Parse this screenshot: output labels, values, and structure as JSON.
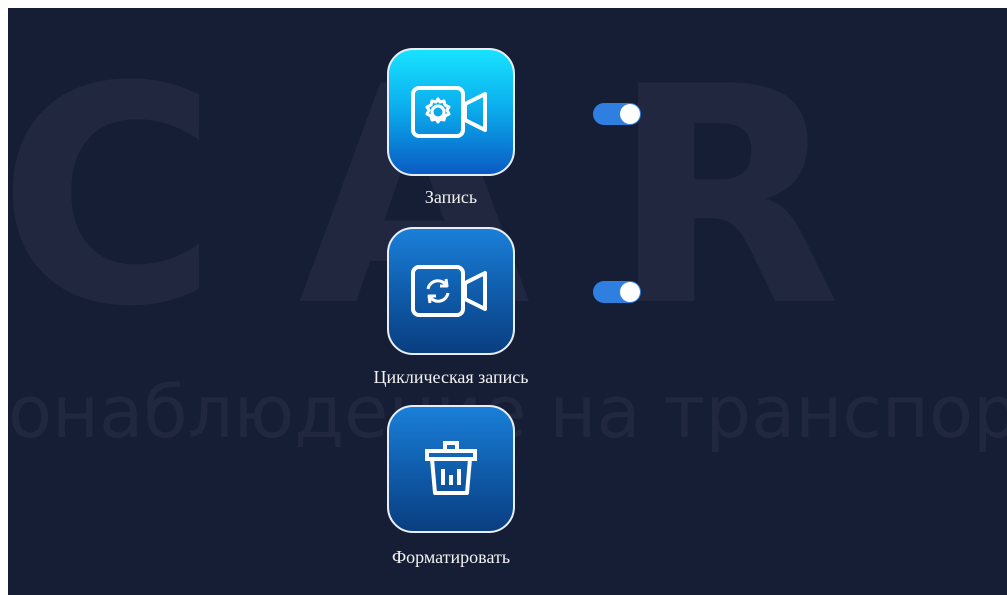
{
  "watermark": {
    "big": "CAR VIS",
    "small": "онаблюдение на транспор"
  },
  "menu": {
    "items": [
      {
        "label": "Запись",
        "icon": "camera-settings-icon",
        "toggle": true
      },
      {
        "label": "Циклическая запись",
        "icon": "camera-loop-icon",
        "toggle": true
      },
      {
        "label": "Форматировать",
        "icon": "trash-icon"
      }
    ]
  },
  "colors": {
    "background": "#161e36",
    "toggle_on": "#2f7fe0",
    "tile_active_top": "#18e2ff",
    "tile_blue": "#0f5aa8"
  }
}
